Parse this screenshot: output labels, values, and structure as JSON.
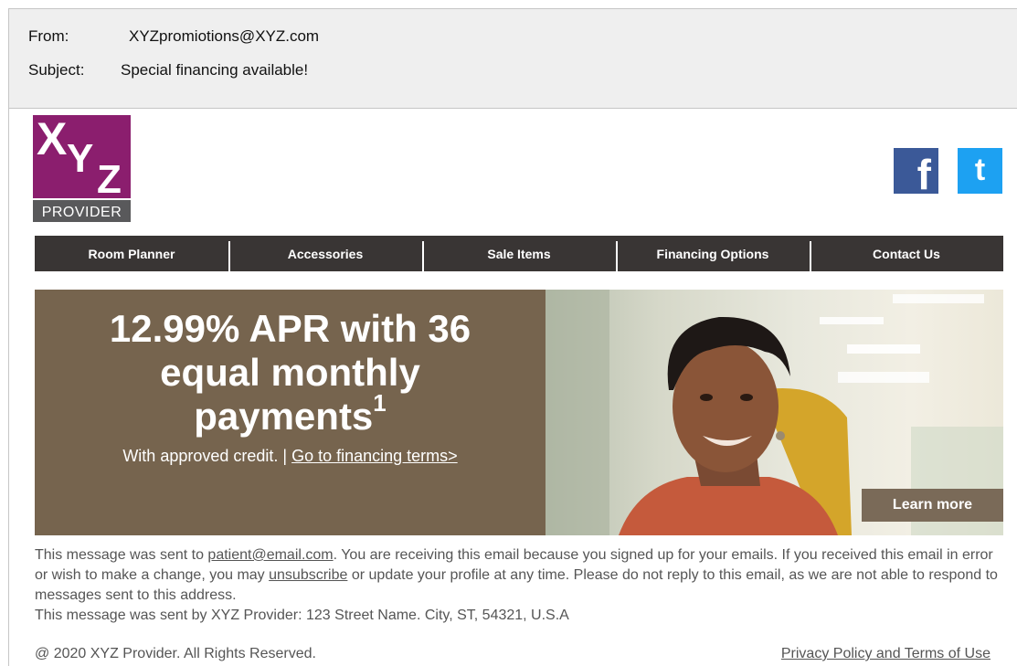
{
  "email": {
    "from_label": "From:",
    "from_value": "XYZpromiotions@XYZ.com",
    "subject_label": "Subject:",
    "subject_value": "Special financing available!"
  },
  "logo": {
    "x": "X",
    "y": "Y",
    "z": "Z",
    "provider": "PROVIDER"
  },
  "social": {
    "facebook_glyph": "f",
    "twitter_glyph": "t",
    "facebook_color": "#3b5998",
    "twitter_color": "#1da1f2"
  },
  "nav": {
    "items": [
      {
        "label": "Room Planner"
      },
      {
        "label": "Accessories"
      },
      {
        "label": "Sale Items"
      },
      {
        "label": "Financing Options"
      },
      {
        "label": "Contact Us"
      }
    ]
  },
  "promo": {
    "headline_line1": "12.99% APR with 36",
    "headline_line2": "equal monthly",
    "headline_line3": "payments",
    "footnote_mark": "1",
    "sub_text": "With approved credit. | ",
    "terms_link": "Go to financing terms>",
    "learn_more": "Learn more",
    "background_color": "#76644e"
  },
  "footer": {
    "text_before_email": "This message was sent to ",
    "email_link": "patient@email.com",
    "text_after_email": ". You are receiving this email because you signed up for your emails. If you received this email in error or wish to make a change, you may ",
    "unsubscribe_link": "unsubscribe",
    "text_after_unsubscribe": " or update your profile at any time. Please do not reply to this email, as we are not able to respond to messages sent to this address.",
    "address_line": "This message was sent by XYZ Provider: 123 Street Name. City, ST, 54321, U.S.A",
    "copyright": "@ 2020 XYZ Provider. All Rights Reserved.",
    "privacy_link": "Privacy Policy and Terms of Use"
  }
}
